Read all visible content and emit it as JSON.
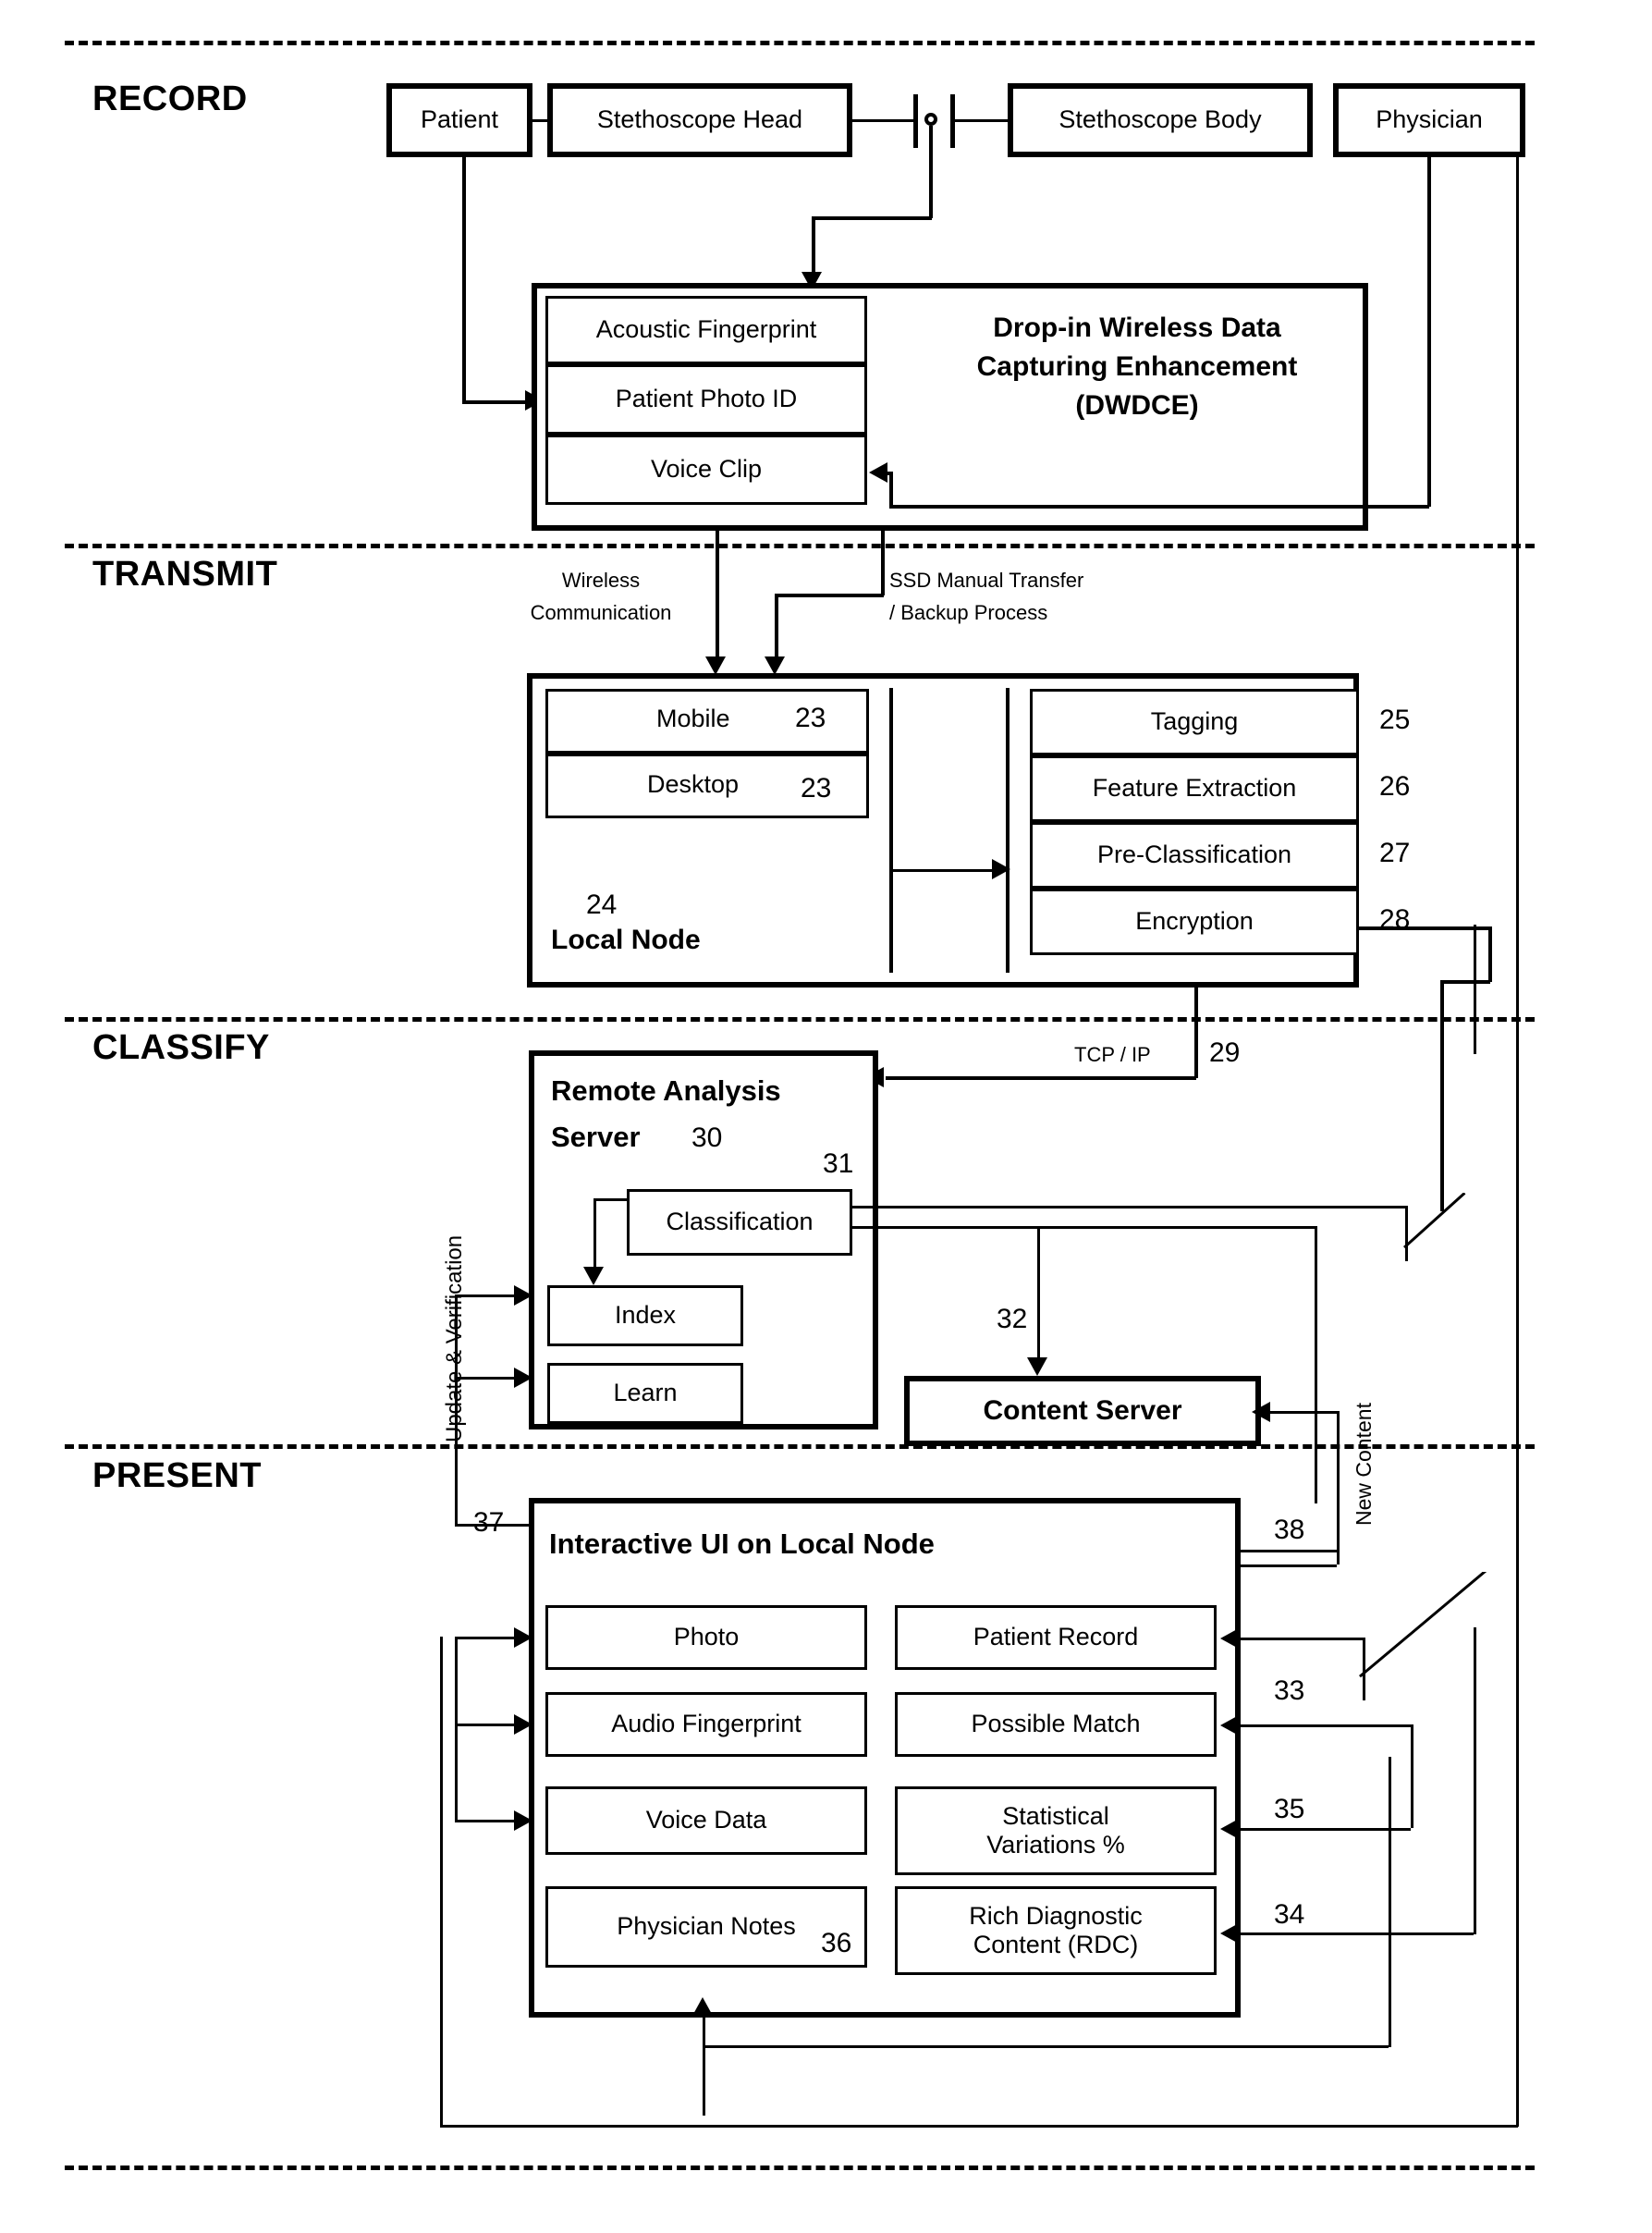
{
  "figure": {
    "phases": [
      {
        "name": "RECORD"
      },
      {
        "name": "TRANSMIT"
      },
      {
        "name": "CLASSIFY"
      },
      {
        "name": "PRESENT"
      }
    ]
  },
  "record": {
    "patient": "Patient",
    "steth_head": "Stethoscope Head",
    "steth_body": "Stethoscope Body",
    "physician": "Physician",
    "dwdce_title_l1": "Drop-in Wireless Data",
    "dwdce_title_l2": "Capturing Enhancement",
    "dwdce_title_l3": "(DWDCE)",
    "items": [
      {
        "label": "Acoustic Fingerprint"
      },
      {
        "label": "Patient Photo ID"
      },
      {
        "label": "Voice Clip"
      }
    ]
  },
  "transmit": {
    "wireless_l1": "Wireless",
    "wireless_l2": "Communication",
    "ssd_l1": "SSD Manual Transfer",
    "ssd_l2": "/ Backup Process",
    "local_node_label": "Local Node",
    "local_node_num": "24",
    "devices": [
      {
        "label": "Mobile",
        "num": "23"
      },
      {
        "label": "Desktop",
        "num": "23"
      }
    ],
    "processes": [
      {
        "label": "Tagging",
        "num": "25"
      },
      {
        "label": "Feature Extraction",
        "num": "26"
      },
      {
        "label": "Pre-Classification",
        "num": "27"
      },
      {
        "label": "Encryption",
        "num": "28"
      }
    ]
  },
  "classify": {
    "server_l1": "Remote Analysis",
    "server_l2": "Server",
    "server_num": "30",
    "classification_label": "Classification",
    "classification_num": "31",
    "index_label": "Index",
    "learn_label": "Learn",
    "content_server_label": "Content Server",
    "content_server_num": "32",
    "tcpip_label": "TCP / IP",
    "tcpip_num": "29",
    "update_verification": "Update & Verification",
    "new_content": "New Content"
  },
  "present": {
    "ui_title": "Interactive UI on Local Node",
    "ui_num": "37",
    "num_38": "38",
    "left_items": [
      {
        "label": "Photo"
      },
      {
        "label": "Audio Fingerprint"
      },
      {
        "label": "Voice Data"
      },
      {
        "label": "Physician Notes",
        "num": "36"
      }
    ],
    "right_items": [
      {
        "label": "Patient Record",
        "num": "33"
      },
      {
        "label": "Possible Match"
      },
      {
        "label_l1": "Statistical",
        "label_l2": "Variations %",
        "num": "35"
      },
      {
        "label_l1": "Rich Diagnostic",
        "label_l2": "Content (RDC)",
        "num": "34"
      }
    ]
  }
}
